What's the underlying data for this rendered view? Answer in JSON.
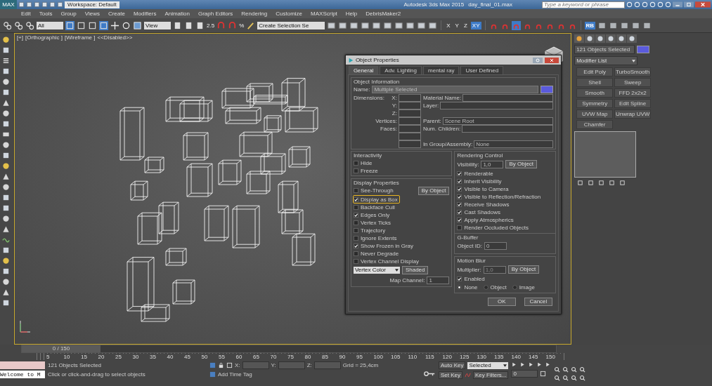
{
  "title_bar": {
    "app_button": "MAX",
    "workspace": "Workspace: Default",
    "app_title": "Autodesk 3ds Max 2015",
    "file_name": "day_final_01.max",
    "search": {
      "placeholder": "Type a keyword or phrase"
    }
  },
  "menu": [
    "Edit",
    "Tools",
    "Group",
    "Views",
    "Create",
    "Modifiers",
    "Animation",
    "Graph Editors",
    "Rendering",
    "Customize",
    "MAXScript",
    "Help",
    "DebrisMaker2"
  ],
  "toolbar": {
    "selection_filter": "All",
    "reference_coordinate": "View",
    "snap_label": "2.5",
    "percent_label": "%",
    "named_selection": "Create Selection Se",
    "axes": [
      {
        "label": "X",
        "selected": false
      },
      {
        "label": "Y",
        "selected": false
      },
      {
        "label": "Z",
        "selected": false
      },
      {
        "label": "XY",
        "selected": true
      }
    ],
    "render_label": "RB"
  },
  "viewport": {
    "labels": [
      "[+]",
      "[Orthographic ]",
      "[Wireframe ]",
      "<<Disabled>>"
    ]
  },
  "dialog": {
    "title": "Object Properties",
    "tabs": [
      {
        "label": "General",
        "selected": true
      },
      {
        "label": "Adv. Lighting",
        "selected": false
      },
      {
        "label": "mental ray",
        "selected": false
      },
      {
        "label": "User Defined",
        "selected": false
      }
    ],
    "object_info": {
      "title": "Object Information",
      "name_label": "Name:",
      "name": "Multiple Selected",
      "color": "#5b5bdc",
      "dimensions_label": "Dimensions:",
      "left_fields": [
        {
          "label": "X:"
        },
        {
          "label": "Y:"
        },
        {
          "label": "Z:"
        },
        {
          "label": "Vertices:"
        },
        {
          "label": "Faces:"
        },
        {
          "kind": "unlabeled"
        },
        {
          "kind": "unlabeled"
        }
      ],
      "right_fields": [
        {
          "label": "Material Name:"
        },
        {
          "label": "Layer:"
        },
        {
          "kind": "spacer"
        },
        {
          "label": "Parent:",
          "value": "Scene Root"
        },
        {
          "label": "Num. Children:"
        },
        {
          "kind": "spacer"
        },
        {
          "label": "In Group/Assembly:",
          "value": "None"
        }
      ]
    },
    "interactivity": {
      "title": "Interactivity",
      "options": [
        {
          "label": "Hide",
          "checked": false
        },
        {
          "label": "Freeze",
          "checked": false
        }
      ]
    },
    "display": {
      "title": "Display Properties",
      "by_object": "By Object",
      "options": [
        {
          "label": "See-Through",
          "checked": false,
          "highlighted": false
        },
        {
          "label": "Display as Box",
          "checked": true,
          "highlighted": true
        },
        {
          "label": "Backface Cull",
          "checked": false,
          "highlighted": false
        },
        {
          "label": "Edges Only",
          "checked": true,
          "highlighted": false
        },
        {
          "label": "Vertex Ticks",
          "checked": false,
          "highlighted": false
        },
        {
          "label": "Trajectory",
          "checked": false,
          "highlighted": false
        },
        {
          "label": "Ignore Extents",
          "checked": false,
          "highlighted": false
        },
        {
          "label": "Show Frozen in Gray",
          "checked": true,
          "highlighted": false
        },
        {
          "label": "Never Degrade",
          "checked": false,
          "highlighted": false
        },
        {
          "label": "Vertex Channel Display",
          "checked": false,
          "highlighted": false
        }
      ],
      "channel_type": "Vertex Color",
      "shaded": "Shaded",
      "map_channel_label": "Map Channel:",
      "map_channel": "1"
    },
    "rendering": {
      "title": "Rendering Control",
      "visibility_label": "Visibility:",
      "visibility": "1,0",
      "by_object": "By Object",
      "options": [
        {
          "label": "Renderable",
          "checked": true
        },
        {
          "label": "Inherit Visibility",
          "checked": true
        },
        {
          "label": "Visible to Camera",
          "checked": true
        },
        {
          "label": "Visible to Reflection/Refraction",
          "checked": true
        },
        {
          "label": "Receive Shadows",
          "checked": true
        },
        {
          "label": "Cast Shadows",
          "checked": true
        },
        {
          "label": "Apply Atmospherics",
          "checked": true
        },
        {
          "label": "Render Occluded Objects",
          "checked": false
        }
      ]
    },
    "gbuffer": {
      "title": "G-Buffer",
      "object_id_label": "Object ID:",
      "object_id": "0"
    },
    "motion_blur": {
      "title": "Motion Blur",
      "multiplier_label": "Multiplier:",
      "multiplier": "1,0",
      "by_object": "By Object",
      "enabled": {
        "label": "Enabled",
        "checked": true
      },
      "modes": [
        {
          "label": "None",
          "selected": true
        },
        {
          "label": "Object",
          "selected": false
        },
        {
          "label": "Image",
          "selected": false
        }
      ]
    },
    "buttons": [
      "OK",
      "Cancel"
    ]
  },
  "command_panel": {
    "selection": "121 Objects Selected",
    "color": "#5b5bdc",
    "modifier_list": "Modifier List",
    "modifiers": [
      "Edit Poly",
      "TurboSmooth",
      "Shell",
      "Sweep",
      "Smooth",
      "FFD 2x2x2",
      "Symmetry",
      "Edit Spline",
      "UVW Map",
      "Unwrap UVW",
      "Chamfer"
    ]
  },
  "timeline": {
    "frame": "0 / 150",
    "level": 0,
    "ticks": [
      "5",
      "10",
      "15",
      "20",
      "25",
      "30",
      "35",
      "40",
      "45",
      "50",
      "55",
      "60",
      "65",
      "70",
      "75",
      "80",
      "85",
      "90",
      "95",
      "100",
      "105",
      "110",
      "115",
      "120",
      "125",
      "130",
      "135",
      "140",
      "145",
      "150"
    ]
  },
  "status": {
    "listener": "Welcome to M",
    "selection": "121 Objects Selected",
    "prompt": "Click or click-and-drag to select objects",
    "coords": [
      "X:",
      "Y:",
      "Z:"
    ],
    "grid": "Grid = 25,4cm",
    "time_tag": "Add Time Tag",
    "auto_key": "Auto Key",
    "key_mode": "Selected",
    "set_key": "Set Key",
    "key_filters": "Key Filters...",
    "frame": "0"
  }
}
